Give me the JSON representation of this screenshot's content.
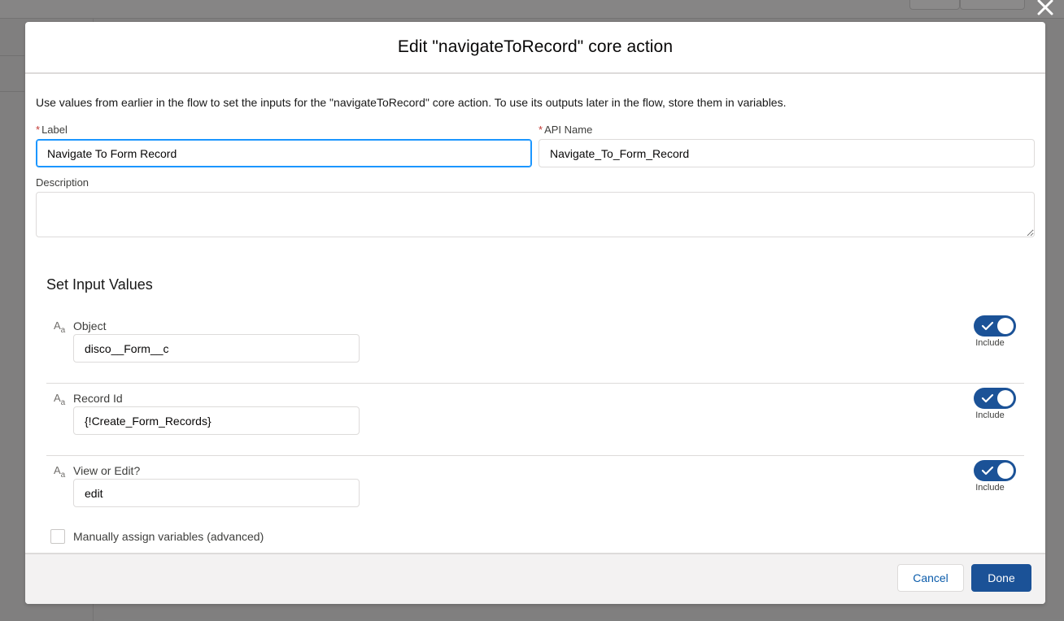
{
  "modal": {
    "title": "Edit \"navigateToRecord\" core action",
    "intro": "Use values from earlier in the flow to set the inputs for the \"navigateToRecord\" core action. To use its outputs later in the flow, store them in variables."
  },
  "fields": {
    "label": {
      "label": "Label",
      "value": "Navigate To Form Record",
      "required": "*"
    },
    "api_name": {
      "label": "API Name",
      "value": "Navigate_To_Form_Record",
      "required": "*"
    },
    "description": {
      "label": "Description",
      "value": ""
    }
  },
  "inputs_section": {
    "title": "Set Input Values",
    "type_icon": {
      "big": "A",
      "small": "a"
    },
    "rows": [
      {
        "label": "Object",
        "value": "disco__Form__c",
        "toggle_caption": "Include",
        "included": true
      },
      {
        "label": "Record Id",
        "value": "{!Create_Form_Records}",
        "toggle_caption": "Include",
        "included": true
      },
      {
        "label": "View or Edit?",
        "value": "edit",
        "toggle_caption": "Include",
        "included": true
      }
    ],
    "manual_assign_label": "Manually assign variables (advanced)"
  },
  "footer": {
    "cancel_label": "Cancel",
    "done_label": "Done"
  },
  "colors": {
    "brand": "#1b5297",
    "link": "#0b5cab",
    "focus": "#1b96ff",
    "required": "#c23934"
  }
}
